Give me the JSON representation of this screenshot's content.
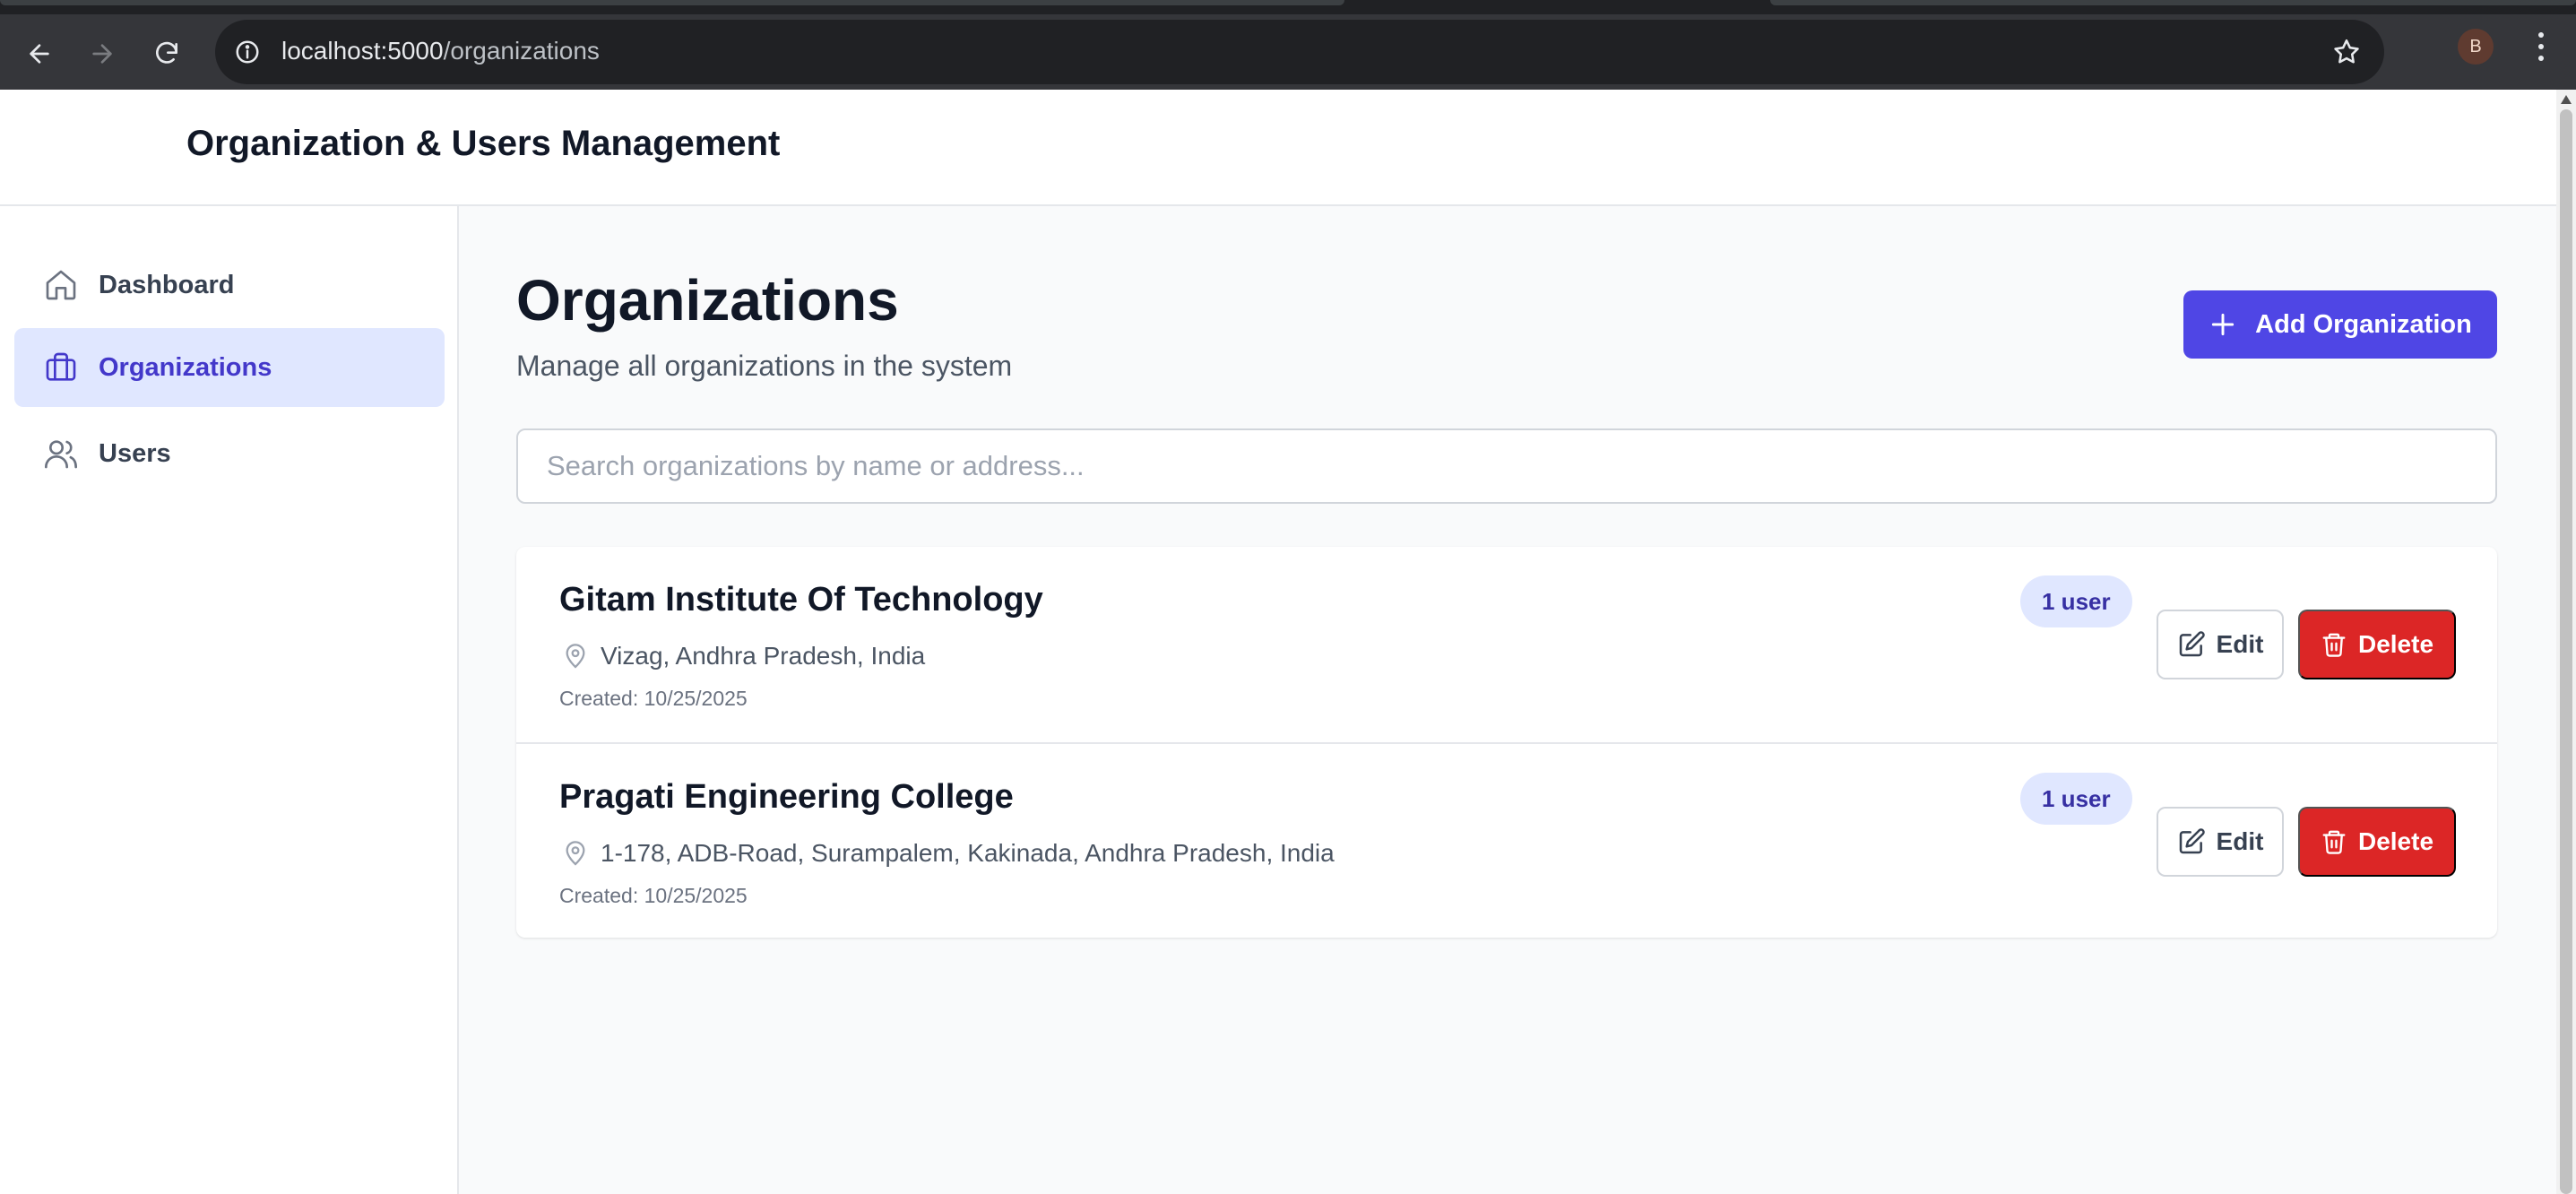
{
  "browser": {
    "url_host": "localhost:5000",
    "url_path": "/organizations",
    "profile_initial": "B"
  },
  "app": {
    "title": "Organization & Users Management"
  },
  "sidebar": {
    "items": [
      {
        "label": "Dashboard",
        "icon": "home-icon",
        "active": false
      },
      {
        "label": "Organizations",
        "icon": "briefcase-icon",
        "active": true
      },
      {
        "label": "Users",
        "icon": "users-icon",
        "active": false
      }
    ]
  },
  "page": {
    "title": "Organizations",
    "subtitle": "Manage all organizations in the system",
    "add_button_label": "Add Organization",
    "search_placeholder": "Search organizations by name or address..."
  },
  "organizations": [
    {
      "name": "Gitam Institute Of Technology",
      "address": "Vizag, Andhra Pradesh, India",
      "created": "Created: 10/25/2025",
      "users_badge": "1 user",
      "edit_label": "Edit",
      "delete_label": "Delete"
    },
    {
      "name": "Pragati Engineering College",
      "address": "1-178, ADB-Road, Surampalem, Kakinada, Andhra Pradesh, India",
      "created": "Created: 10/25/2025",
      "users_badge": "1 user",
      "edit_label": "Edit",
      "delete_label": "Delete"
    }
  ],
  "colors": {
    "primary": "#4f46e5",
    "danger": "#dc2626",
    "active_bg": "#e0e7ff",
    "active_text": "#4338ca"
  }
}
